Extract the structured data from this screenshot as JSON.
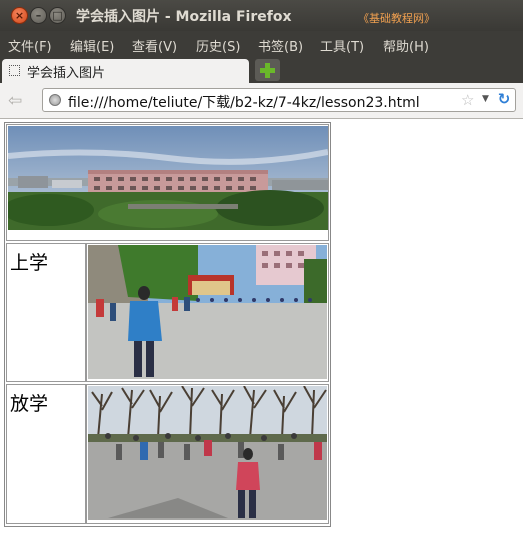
{
  "window": {
    "title": "学会插入图片 - Mozilla Firefox",
    "watermark": "《基础教程网》",
    "close_glyph": "×",
    "min_glyph": "–",
    "max_glyph": "□"
  },
  "menu": [
    "文件(F)",
    "编辑(E)",
    "查看(V)",
    "历史(S)",
    "书签(B)",
    "工具(T)",
    "帮助(H)"
  ],
  "tab": {
    "title": "学会插入图片"
  },
  "nav": {
    "url": "file:///home/teliute/下载/b2-kz/7-4kz/lesson23.html",
    "back_glyph": "⇦",
    "star_glyph": "☆",
    "dropdown_glyph": "▼",
    "reload_glyph": "↻"
  },
  "table": {
    "rows": [
      {
        "label": "",
        "image": "campus-building-photo"
      },
      {
        "label": "上学",
        "image": "students-arriving-photo"
      },
      {
        "label": "放学",
        "image": "students-leaving-photo"
      }
    ]
  },
  "colors": {
    "accent": "#6ab82a",
    "titlebar": "#3d3c38",
    "close": "#e0591f"
  }
}
